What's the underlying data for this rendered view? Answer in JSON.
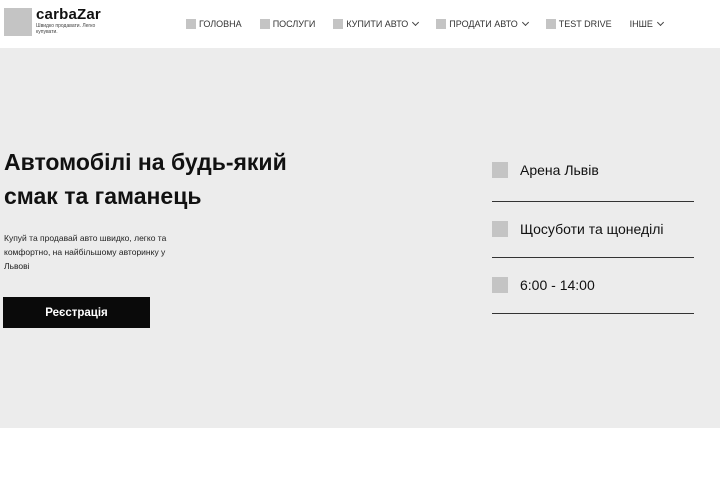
{
  "brand": {
    "name": "carbaZar",
    "tagline": "Швидко продавати. Легко купувати."
  },
  "nav": {
    "items": [
      {
        "label": "Головна",
        "dropdown": false
      },
      {
        "label": "Послуги",
        "dropdown": false
      },
      {
        "label": "Купити авто",
        "dropdown": true
      },
      {
        "label": "Продати авто",
        "dropdown": true
      },
      {
        "label": "Test drive",
        "dropdown": false
      },
      {
        "label": "Інше",
        "dropdown": true
      }
    ]
  },
  "hero": {
    "title": "Автомобілі на будь-який смак та гаманець",
    "subtitle": "Купуй та продавай авто швидко, легко та комфортно, на найбільшому авторинку у Львові",
    "button_label": "Реєстрація"
  },
  "info": {
    "items": [
      {
        "text": "Арена Львів",
        "icon": "location-icon"
      },
      {
        "text": "Щосуботи та щонеділі",
        "icon": "calendar-icon"
      },
      {
        "text": "6:00 - 14:00",
        "icon": "clock-icon"
      }
    ]
  },
  "colors": {
    "hero_bg": "#ececec",
    "placeholder": "#c4c4c4",
    "button_bg": "#0a0a0a",
    "button_text": "#ffffff"
  }
}
